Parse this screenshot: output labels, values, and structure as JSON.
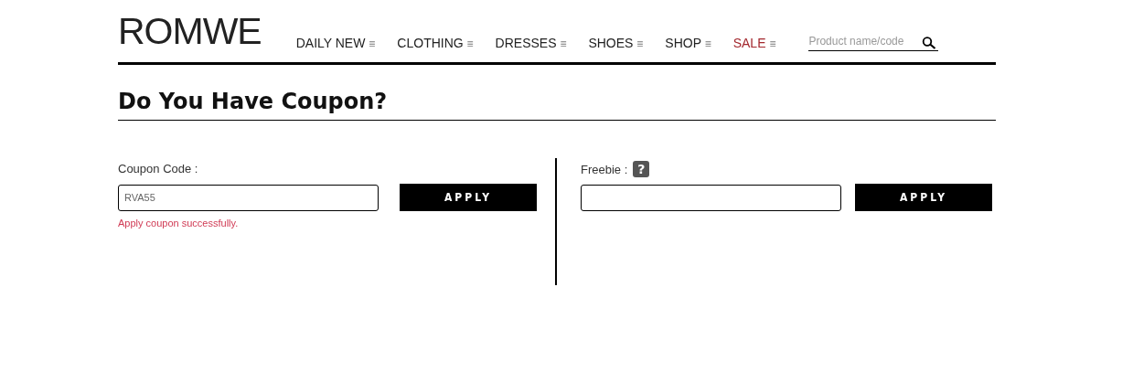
{
  "header": {
    "logo": "ROMWE",
    "nav": [
      {
        "label": "DAILY NEW",
        "icon": "≡",
        "kind": "normal"
      },
      {
        "label": "CLOTHING",
        "icon": "≡",
        "kind": "normal"
      },
      {
        "label": "DRESSES",
        "icon": "≡",
        "kind": "normal"
      },
      {
        "label": "SHOES",
        "icon": "≡",
        "kind": "normal"
      },
      {
        "label": "SHOP",
        "icon": "≡",
        "kind": "normal"
      },
      {
        "label": "SALE",
        "icon": "≡",
        "kind": "sale"
      }
    ],
    "search": {
      "placeholder": "Product name/code"
    }
  },
  "title": "Do You Have Coupon?",
  "coupon": {
    "label": "Coupon Code :",
    "value": "RVA55",
    "button": "APPLY",
    "message": "Apply coupon successfully."
  },
  "freebie": {
    "label": "Freebie :",
    "help": "?",
    "button": "APPLY"
  }
}
